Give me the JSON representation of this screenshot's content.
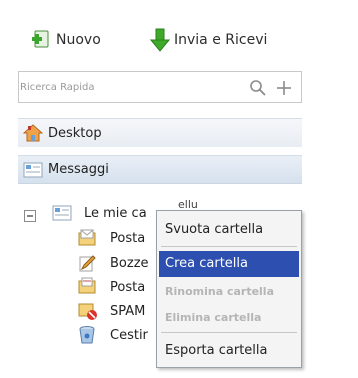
{
  "toolbar": {
    "new_label": "Nuovo",
    "send_receive_label": "Invia e Ricevi"
  },
  "search": {
    "placeholder": "Ricerca Rapida"
  },
  "nav": {
    "desktop_label": "Desktop",
    "messages_label": "Messaggi"
  },
  "tree": {
    "root_label": "Le mie cartelle",
    "root_label_visible": "Le mie ca",
    "root_label_tail": "ellu",
    "items": [
      {
        "label": "Posta",
        "icon": "inbox-folder-icon"
      },
      {
        "label": "Bozze",
        "icon": "drafts-pencil-icon"
      },
      {
        "label": "Posta",
        "icon": "sent-folder-icon"
      },
      {
        "label": "SPAM",
        "icon": "spam-folder-icon"
      },
      {
        "label": "Cestir",
        "icon": "trash-bin-icon"
      }
    ]
  },
  "context_menu": {
    "items": [
      {
        "label": "Svuota cartella",
        "state": "normal"
      },
      {
        "label": "Crea cartella",
        "state": "highlighted"
      },
      {
        "label": "Rinomina cartella",
        "state": "disabled"
      },
      {
        "label": "Elimina cartella",
        "state": "disabled"
      },
      {
        "label": "Esporta cartella",
        "state": "normal"
      }
    ]
  },
  "colors": {
    "menu_highlight": "#2d4fb0",
    "new_icon": "#3aa62c",
    "send_receive_icon": "#3faa2a",
    "nav_messaggi_bg": "#d6e1ee"
  }
}
